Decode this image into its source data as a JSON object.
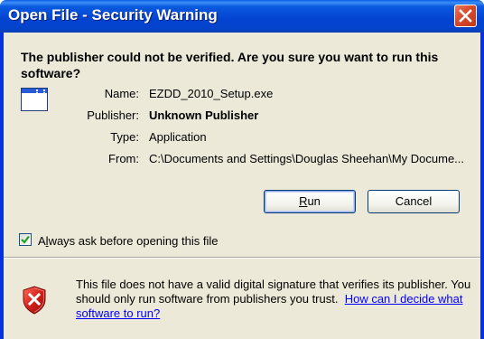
{
  "window": {
    "title": "Open File - Security Warning",
    "close_icon": "close-icon"
  },
  "header": {
    "message": "The publisher could not be verified.  Are you sure you want to run this software?"
  },
  "file_info": {
    "icon": "application-window-icon",
    "fields": [
      {
        "label": "Name:",
        "value": "EZDD_2010_Setup.exe"
      },
      {
        "label": "Publisher:",
        "value": "Unknown Publisher"
      },
      {
        "label": "Type:",
        "value": "Application"
      },
      {
        "label": "From:",
        "value": "C:\\Documents and Settings\\Douglas Sheehan\\My Docume..."
      }
    ]
  },
  "buttons": {
    "run_accel": "R",
    "run_rest": "un",
    "cancel": "Cancel"
  },
  "checkbox": {
    "checked": true,
    "label_prefix": "A",
    "label_accel": "l",
    "label_rest": "ways ask before opening this file"
  },
  "warning": {
    "icon": "shield-x-icon",
    "text": "This file does not have a valid digital signature that verifies its publisher. You should only run software from publishers you trust.",
    "link": "How can I decide what software to run?"
  },
  "colors": {
    "title_bar": "#0443d0",
    "close_button": "#d8492a",
    "dialog_background": "#ece9d8",
    "link": "#0000ff",
    "checkmark": "#21a121"
  }
}
